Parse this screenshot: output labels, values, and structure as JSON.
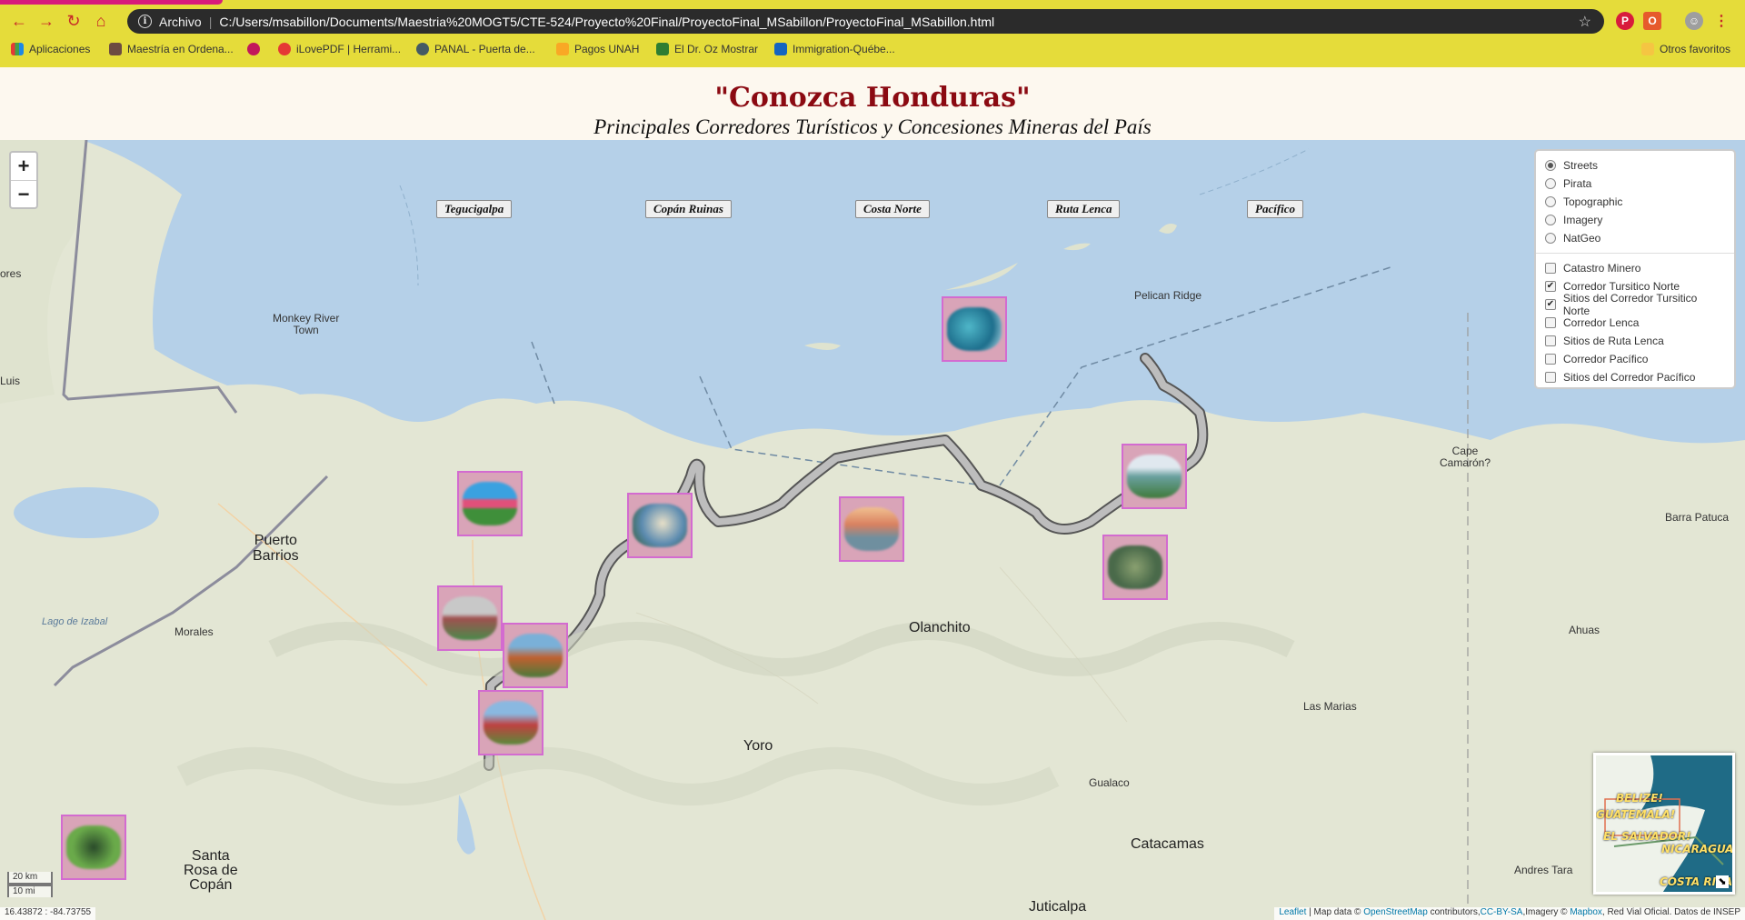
{
  "browser": {
    "address_prefix": "Archivo",
    "url": "C:/Users/msabillon/Documents/Maestria%20MOGT5/CTE-524/Proyecto%20Final/ProyectoFinal_MSabillon/ProyectoFinal_MSabillon.html",
    "bookmarks": [
      "Aplicaciones",
      "Maestría en Ordena...",
      "iLovePDF | Herrami...",
      "PANAL - Puerta de...",
      "Pagos UNAH",
      "El Dr. Oz Mostrar",
      "Immigration-Québe..."
    ],
    "other_bookmarks": "Otros favoritos"
  },
  "page": {
    "title": "\"Conozca Honduras\"",
    "subtitle": "Principales Corredores Turísticos y Concesiones Mineras del País"
  },
  "map": {
    "zoom_in": "+",
    "zoom_out": "−",
    "route_buttons": [
      "Tegucigalpa",
      "Copán Ruinas",
      "Costa Norte",
      "Ruta Lenca",
      "Pacífico"
    ],
    "base_layers": [
      {
        "label": "Streets",
        "selected": true
      },
      {
        "label": "Pirata",
        "selected": false
      },
      {
        "label": "Topographic",
        "selected": false
      },
      {
        "label": "Imagery",
        "selected": false
      },
      {
        "label": "NatGeo",
        "selected": false
      }
    ],
    "overlays": [
      {
        "label": "Catastro Minero",
        "checked": false
      },
      {
        "label": "Corredor Tursitico Norte",
        "checked": true
      },
      {
        "label": "Sitios del Corredor Tursitico Norte",
        "checked": true
      },
      {
        "label": "Corredor Lenca",
        "checked": false
      },
      {
        "label": "Sitios de Ruta Lenca",
        "checked": false
      },
      {
        "label": "Corredor Pacífico",
        "checked": false
      },
      {
        "label": "Sitios del Corredor Pacífico",
        "checked": false
      }
    ],
    "place_labels": {
      "puerto_barrios": "Puerto\nBarrios",
      "monkey_river": "Monkey River\nTown",
      "morales": "Morales",
      "lago_izabal": "Lago de Izabal",
      "olanchito": "Olanchito",
      "yoro": "Yoro",
      "santa_rosa": "Santa\nRosa de\nCopán",
      "catacamas": "Catacamas",
      "gualaco": "Gualaco",
      "juticalpa": "Juticalpa",
      "las_marias": "Las Marias",
      "ahuas": "Ahuas",
      "barra_patuca": "Barra Patuca",
      "cape_camaron": "Cape\nCamarón?",
      "pelican_ridge": "Pelican Ridge",
      "andres_tara": "Andres Tara",
      "ores": "ores",
      "luis": "Luis"
    },
    "minimap_labels": [
      "BELIZE!",
      "GUATEMALA!",
      "EL SALVADOR!",
      "NICARAGUA!",
      "COSTA RICA"
    ],
    "scale_km": "20 km",
    "scale_mi": "10 mi",
    "coordinates": "16.43872 : -84.73755",
    "attribution": {
      "leaflet": "Leaflet",
      "map_data": " | Map data © ",
      "osm": "OpenStreetMap",
      "contributors": " contributors,",
      "license": "CC-BY-SA",
      "imagery": ",Imagery © ",
      "mapbox": "Mapbox",
      "rest": ", Red Vial Oficial. Datos de INSEP"
    },
    "colors": {
      "sea": "#b5d0e8",
      "land": "#e3e6d4",
      "route": "#8c8c8c",
      "marker_border": "#d36bd0"
    }
  }
}
